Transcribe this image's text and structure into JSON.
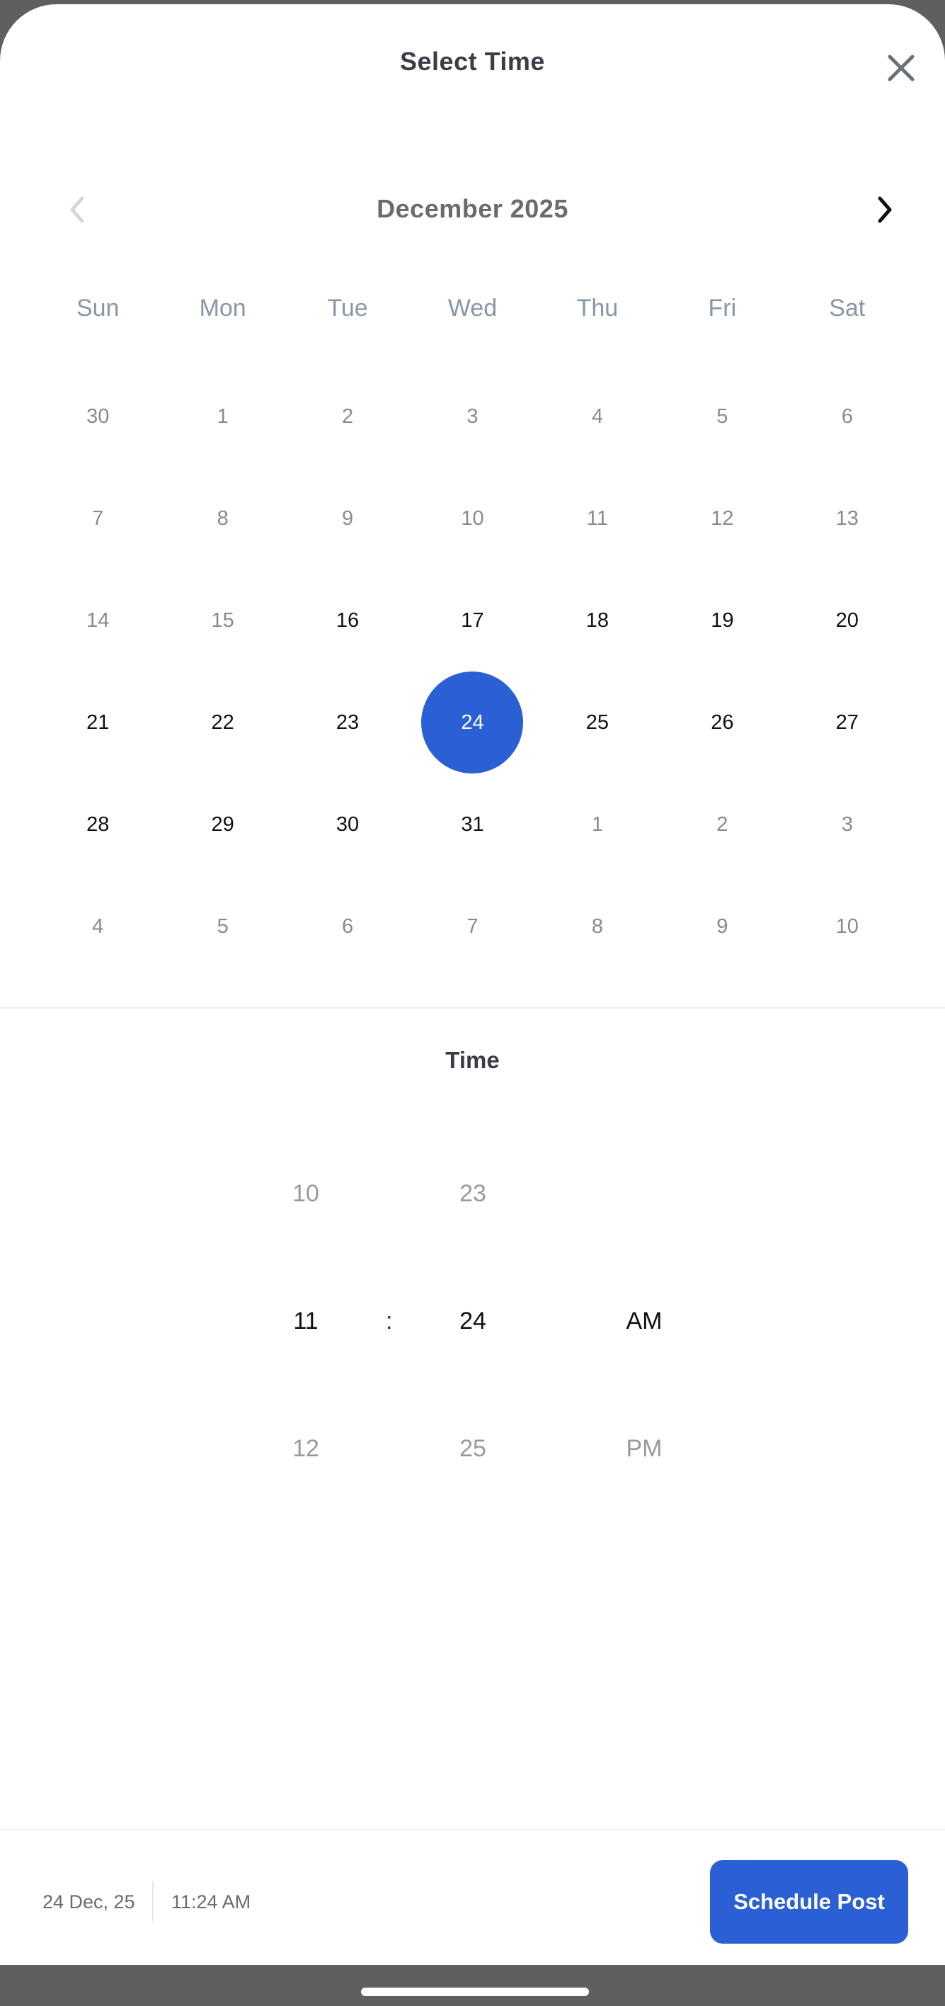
{
  "header": {
    "title": "Select Time",
    "close_icon": "close-icon"
  },
  "calendar": {
    "month_label": "December 2025",
    "prev_icon": "chevron-left-icon",
    "next_icon": "chevron-right-icon",
    "weekdays": [
      "Sun",
      "Mon",
      "Tue",
      "Wed",
      "Thu",
      "Fri",
      "Sat"
    ],
    "days": [
      {
        "label": "30",
        "state": "muted"
      },
      {
        "label": "1",
        "state": "muted"
      },
      {
        "label": "2",
        "state": "muted"
      },
      {
        "label": "3",
        "state": "muted"
      },
      {
        "label": "4",
        "state": "muted"
      },
      {
        "label": "5",
        "state": "muted"
      },
      {
        "label": "6",
        "state": "muted"
      },
      {
        "label": "7",
        "state": "muted"
      },
      {
        "label": "8",
        "state": "muted"
      },
      {
        "label": "9",
        "state": "muted"
      },
      {
        "label": "10",
        "state": "muted"
      },
      {
        "label": "11",
        "state": "muted"
      },
      {
        "label": "12",
        "state": "muted"
      },
      {
        "label": "13",
        "state": "muted"
      },
      {
        "label": "14",
        "state": "muted"
      },
      {
        "label": "15",
        "state": "muted"
      },
      {
        "label": "16",
        "state": "active"
      },
      {
        "label": "17",
        "state": "active"
      },
      {
        "label": "18",
        "state": "active"
      },
      {
        "label": "19",
        "state": "active"
      },
      {
        "label": "20",
        "state": "active"
      },
      {
        "label": "21",
        "state": "active"
      },
      {
        "label": "22",
        "state": "active"
      },
      {
        "label": "23",
        "state": "active"
      },
      {
        "label": "24",
        "state": "selected"
      },
      {
        "label": "25",
        "state": "active"
      },
      {
        "label": "26",
        "state": "active"
      },
      {
        "label": "27",
        "state": "active"
      },
      {
        "label": "28",
        "state": "active"
      },
      {
        "label": "29",
        "state": "active"
      },
      {
        "label": "30",
        "state": "active"
      },
      {
        "label": "31",
        "state": "active"
      },
      {
        "label": "1",
        "state": "muted"
      },
      {
        "label": "2",
        "state": "muted"
      },
      {
        "label": "3",
        "state": "muted"
      },
      {
        "label": "4",
        "state": "muted"
      },
      {
        "label": "5",
        "state": "muted"
      },
      {
        "label": "6",
        "state": "muted"
      },
      {
        "label": "7",
        "state": "muted"
      },
      {
        "label": "8",
        "state": "muted"
      },
      {
        "label": "9",
        "state": "muted"
      },
      {
        "label": "10",
        "state": "muted"
      }
    ],
    "accent_color": "#2b5fd4"
  },
  "time": {
    "title": "Time",
    "separator": ":",
    "hours": {
      "prev": "10",
      "current": "11",
      "next": "12"
    },
    "minutes": {
      "prev": "23",
      "current": "24",
      "next": "25"
    },
    "period": {
      "current": "AM",
      "next": "PM"
    }
  },
  "footer": {
    "date": "24 Dec, 25",
    "time": "11:24 AM",
    "schedule_label": "Schedule Post"
  }
}
